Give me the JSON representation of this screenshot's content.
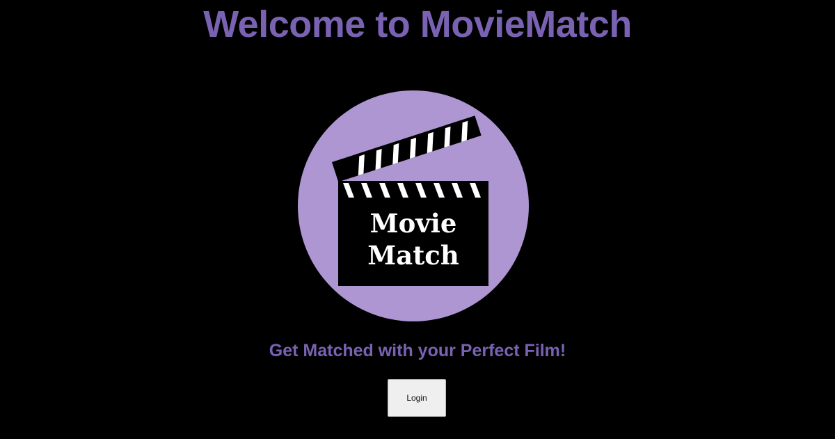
{
  "header": {
    "title": "Welcome to MovieMatch"
  },
  "logo": {
    "line1": "Movie",
    "line2": "Match",
    "icon": "clapperboard-icon",
    "circle_color": "#ad96d2"
  },
  "main": {
    "tagline": "Get Matched with your Perfect Film!",
    "login_label": "Login"
  },
  "colors": {
    "background": "#000000",
    "accent": "#7a62b3"
  }
}
